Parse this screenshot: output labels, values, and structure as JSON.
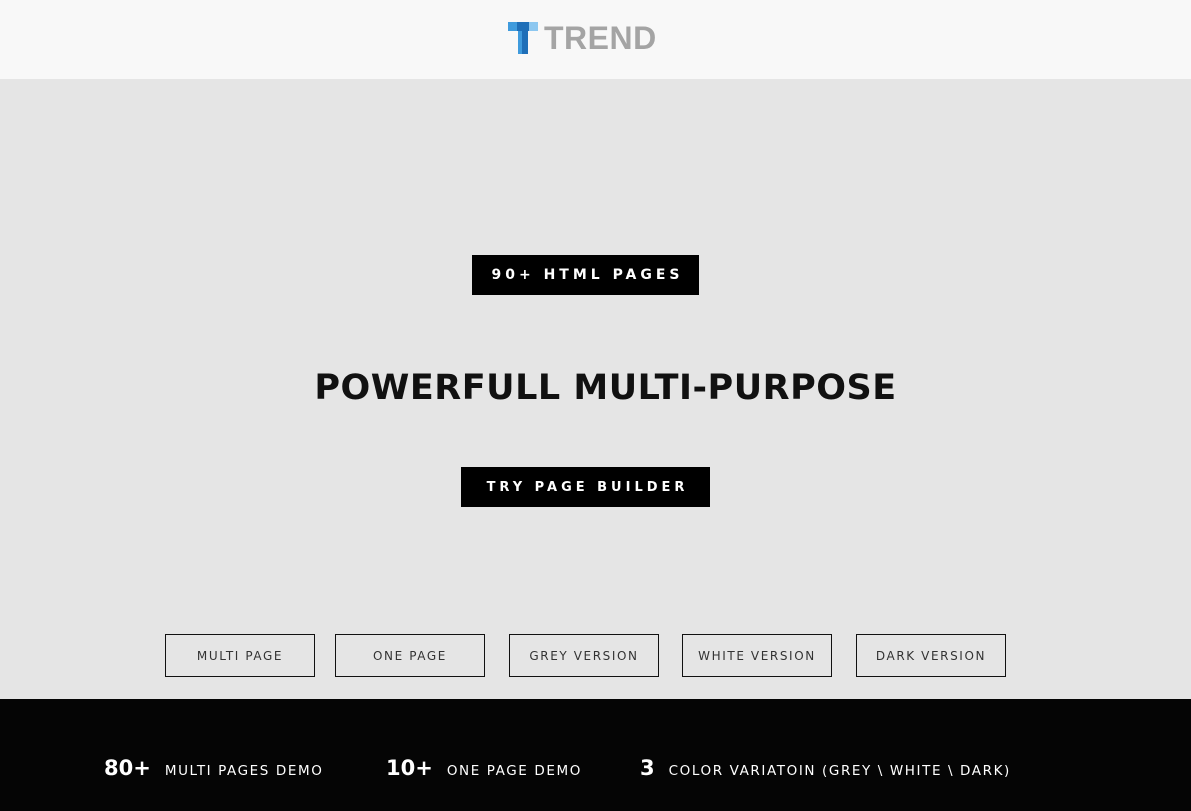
{
  "header": {
    "logo_text": "TREND",
    "logo_icon": "trend-t-logo",
    "logo_colors": [
      "#1f6fb8",
      "#3f9bdd",
      "#8cc7f0"
    ]
  },
  "hero": {
    "badge": "90+ HTML PAGES",
    "title": "POWERFULL MULTI-PURPOSE",
    "cta": "TRY PAGE BUILDER"
  },
  "versions": [
    {
      "label": "MULTI PAGE"
    },
    {
      "label": "ONE PAGE"
    },
    {
      "label": "GREY VERSION"
    },
    {
      "label": "WHITE VERSION"
    },
    {
      "label": "DARK VERSION"
    }
  ],
  "stats": [
    {
      "number": "80+",
      "label": "MULTI PAGES DEMO"
    },
    {
      "number": "10+",
      "label": "ONE PAGE DEMO"
    },
    {
      "number": "3",
      "label": "COLOR VARIATOIN (GREY \\ WHITE \\ DARK)"
    }
  ],
  "colors": {
    "background": "#e5e5e5",
    "header_bg": "#f8f8f8",
    "footer_bg": "#050505",
    "accent": "#000000"
  }
}
